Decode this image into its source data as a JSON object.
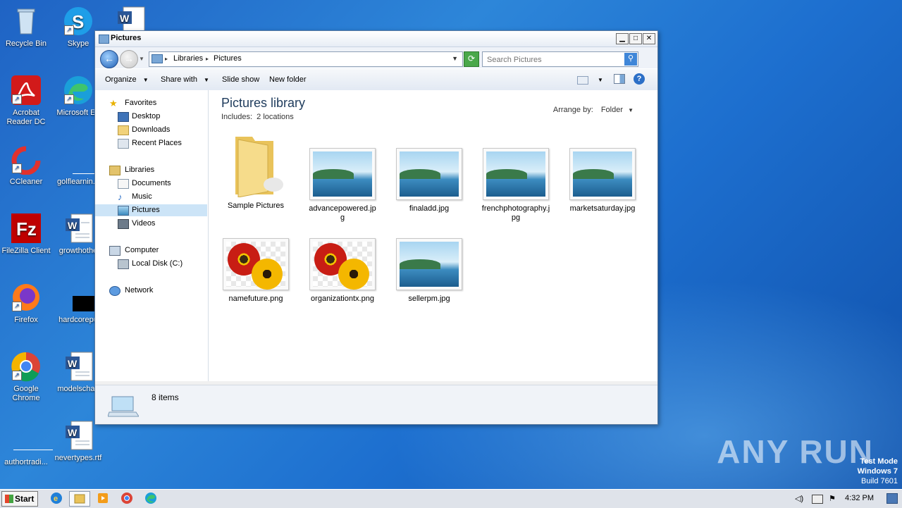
{
  "desktop": {
    "icons": [
      {
        "label": "Recycle Bin"
      },
      {
        "label": "Skype"
      },
      {
        "label": "Acrobat Reader DC"
      },
      {
        "label": "Microsoft Ed"
      },
      {
        "label": "CCleaner"
      },
      {
        "label": "golflearnin..."
      },
      {
        "label": "FileZilla Client"
      },
      {
        "label": "growthothe"
      },
      {
        "label": "Firefox"
      },
      {
        "label": "hardcorepu"
      },
      {
        "label": "Google Chrome"
      },
      {
        "label": "modelschan"
      },
      {
        "label": "authortradi..."
      },
      {
        "label": "nevertypes.rtf"
      }
    ]
  },
  "window": {
    "title": "Pictures",
    "address": {
      "crumb1": "Libraries",
      "crumb2": "Pictures"
    },
    "search_placeholder": "Search Pictures",
    "toolbar": {
      "organize": "Organize",
      "share_with": "Share with",
      "slide_show": "Slide show",
      "new_folder": "New folder"
    },
    "nav": {
      "favorites": "Favorites",
      "desktop": "Desktop",
      "downloads": "Downloads",
      "recent_places": "Recent Places",
      "libraries": "Libraries",
      "documents": "Documents",
      "music": "Music",
      "pictures": "Pictures",
      "videos": "Videos",
      "computer": "Computer",
      "local_disk": "Local Disk (C:)",
      "network": "Network"
    },
    "content": {
      "library_title": "Pictures library",
      "includes_label": "Includes:",
      "includes_value": "2 locations",
      "arrange_label": "Arrange by:",
      "arrange_value": "Folder",
      "items": [
        {
          "name": "Sample Pictures"
        },
        {
          "name": "advancepowered.jpg"
        },
        {
          "name": "finaladd.jpg"
        },
        {
          "name": "frenchphotography.jpg"
        },
        {
          "name": "marketsaturday.jpg"
        },
        {
          "name": "namefuture.png"
        },
        {
          "name": "organizationtx.png"
        },
        {
          "name": "sellerpm.jpg"
        }
      ]
    },
    "status": {
      "count": "8 items"
    }
  },
  "taskbar": {
    "start": "Start",
    "clock": "4:32 PM"
  },
  "watermark": {
    "brand": "ANY RUN",
    "line1": "Test Mode",
    "line2": "Windows 7",
    "line3": "Build 7601"
  }
}
